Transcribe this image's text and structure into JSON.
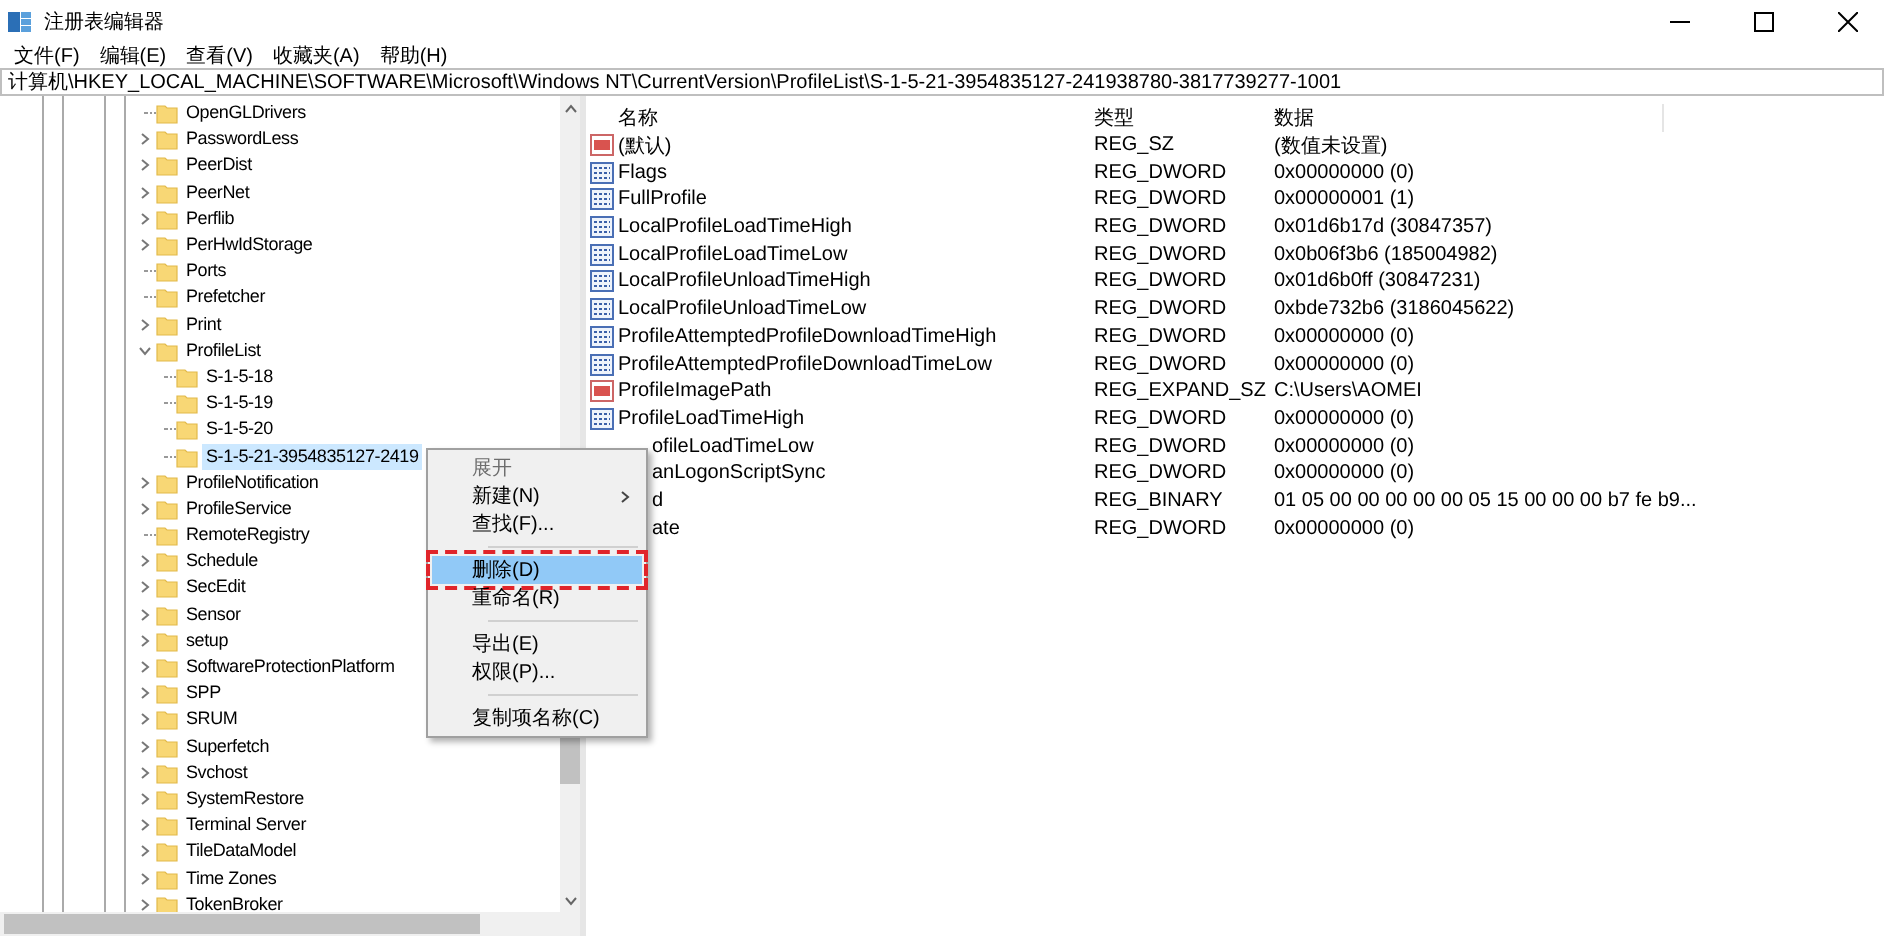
{
  "window": {
    "title": "注册表编辑器"
  },
  "menu_bar": [
    "文件(F)",
    "编辑(E)",
    "查看(V)",
    "收藏夹(A)",
    "帮助(H)"
  ],
  "address": "计算机\\HKEY_LOCAL_MACHINE\\SOFTWARE\\Microsoft\\Windows NT\\CurrentVersion\\ProfileList\\S-1-5-21-3954835127-241938780-3817739277-1001",
  "tree": [
    {
      "label": "OpenGLDrivers",
      "has_children": false
    },
    {
      "label": "PasswordLess",
      "has_children": true
    },
    {
      "label": "PeerDist",
      "has_children": true
    },
    {
      "label": "PeerNet",
      "has_children": true
    },
    {
      "label": "Perflib",
      "has_children": true
    },
    {
      "label": "PerHwIdStorage",
      "has_children": true
    },
    {
      "label": "Ports",
      "has_children": false
    },
    {
      "label": "Prefetcher",
      "has_children": false
    },
    {
      "label": "Print",
      "has_children": true
    },
    {
      "label": "ProfileList",
      "has_children": true,
      "expanded": true,
      "children": [
        {
          "label": "S-1-5-18",
          "has_children": false
        },
        {
          "label": "S-1-5-19",
          "has_children": false
        },
        {
          "label": "S-1-5-20",
          "has_children": false
        },
        {
          "label": "S-1-5-21-3954835127-2419",
          "has_children": false,
          "selected": true
        }
      ]
    },
    {
      "label": "ProfileNotification",
      "has_children": true
    },
    {
      "label": "ProfileService",
      "has_children": true
    },
    {
      "label": "RemoteRegistry",
      "has_children": false
    },
    {
      "label": "Schedule",
      "has_children": true
    },
    {
      "label": "SecEdit",
      "has_children": true
    },
    {
      "label": "Sensor",
      "has_children": true
    },
    {
      "label": "setup",
      "has_children": true
    },
    {
      "label": "SoftwareProtectionPlatform",
      "has_children": true
    },
    {
      "label": "SPP",
      "has_children": true
    },
    {
      "label": "SRUM",
      "has_children": true
    },
    {
      "label": "Superfetch",
      "has_children": true
    },
    {
      "label": "Svchost",
      "has_children": true
    },
    {
      "label": "SystemRestore",
      "has_children": true
    },
    {
      "label": "Terminal Server",
      "has_children": true
    },
    {
      "label": "TileDataModel",
      "has_children": true
    },
    {
      "label": "Time Zones",
      "has_children": true
    },
    {
      "label": "TokenBroker",
      "has_children": true
    }
  ],
  "table": {
    "columns": [
      "名称",
      "类型",
      "数据"
    ],
    "rows": [
      {
        "kind": "string",
        "name": "(默认)",
        "type": "REG_SZ",
        "data": "(数值未设置)"
      },
      {
        "kind": "binary",
        "name": "Flags",
        "type": "REG_DWORD",
        "data": "0x00000000 (0)"
      },
      {
        "kind": "binary",
        "name": "FullProfile",
        "type": "REG_DWORD",
        "data": "0x00000001 (1)"
      },
      {
        "kind": "binary",
        "name": "LocalProfileLoadTimeHigh",
        "type": "REG_DWORD",
        "data": "0x01d6b17d (30847357)"
      },
      {
        "kind": "binary",
        "name": "LocalProfileLoadTimeLow",
        "type": "REG_DWORD",
        "data": "0x0b06f3b6 (185004982)"
      },
      {
        "kind": "binary",
        "name": "LocalProfileUnloadTimeHigh",
        "type": "REG_DWORD",
        "data": "0x01d6b0ff (30847231)"
      },
      {
        "kind": "binary",
        "name": "LocalProfileUnloadTimeLow",
        "type": "REG_DWORD",
        "data": "0xbde732b6 (3186045622)"
      },
      {
        "kind": "binary",
        "name": "ProfileAttemptedProfileDownloadTimeHigh",
        "type": "REG_DWORD",
        "data": "0x00000000 (0)"
      },
      {
        "kind": "binary",
        "name": "ProfileAttemptedProfileDownloadTimeLow",
        "type": "REG_DWORD",
        "data": "0x00000000 (0)"
      },
      {
        "kind": "string",
        "name": "ProfileImagePath",
        "type": "REG_EXPAND_SZ",
        "data": "C:\\Users\\AOMEI"
      },
      {
        "kind": "binary",
        "name": "ProfileLoadTimeHigh",
        "type": "REG_DWORD",
        "data": "0x00000000 (0)"
      },
      {
        "kind": "covered",
        "name": "ofileLoadTimeLow",
        "type": "REG_DWORD",
        "data": "0x00000000 (0)"
      },
      {
        "kind": "covered",
        "name": "anLogonScriptSync",
        "type": "REG_DWORD",
        "data": "0x00000000 (0)"
      },
      {
        "kind": "covered",
        "name": "d",
        "type": "REG_BINARY",
        "data": "01 05 00 00 00 00 00 05 15 00 00 00 b7 fe b9..."
      },
      {
        "kind": "covered",
        "name": "ate",
        "type": "REG_DWORD",
        "data": "0x00000000 (0)"
      }
    ]
  },
  "context_menu": {
    "groups": [
      [
        {
          "label": "展开",
          "disabled": true,
          "selected": false
        },
        {
          "label": "新建(N)",
          "disabled": false,
          "selected": false,
          "submenu": true
        },
        {
          "label": "查找(F)...",
          "disabled": false,
          "selected": false
        }
      ],
      [
        {
          "label": "删除(D)",
          "disabled": false,
          "selected": true
        },
        {
          "label": "重命名(R)",
          "disabled": false,
          "selected": false
        }
      ],
      [
        {
          "label": "导出(E)",
          "disabled": false,
          "selected": false
        },
        {
          "label": "权限(P)...",
          "disabled": false,
          "selected": false
        }
      ],
      [
        {
          "label": "复制项名称(C)",
          "disabled": false,
          "selected": false
        }
      ]
    ]
  }
}
